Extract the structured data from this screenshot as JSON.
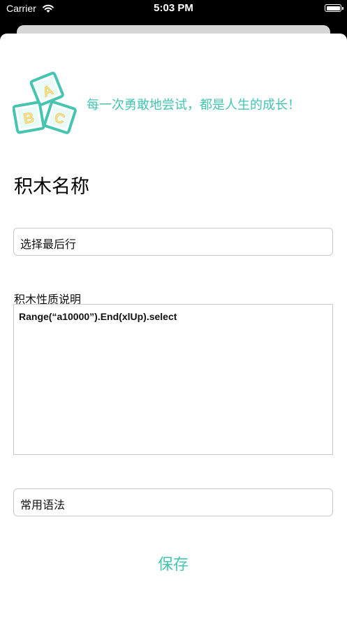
{
  "status_bar": {
    "carrier": "Carrier",
    "time": "5:03 PM",
    "wifi_icon": "wifi-icon",
    "battery_icon": "battery-icon",
    "battery_level": 1.0
  },
  "header": {
    "logo_icon": "abc-blocks-icon",
    "logo_letters": [
      "A",
      "B",
      "C"
    ],
    "slogan": "每一次勇敢地尝试，都是人生的成长！"
  },
  "form": {
    "name_title": "积木名称",
    "name_value": "选择最后行",
    "description_label": "积木性质说明",
    "description_value": "Range(“a10000”).End(xlUp).select",
    "category_value": "常用语法",
    "save_label": "保存"
  },
  "colors": {
    "accent": "#45c4b0",
    "block_yellow": "#f7e08b",
    "block_teal": "#45c4b0"
  }
}
